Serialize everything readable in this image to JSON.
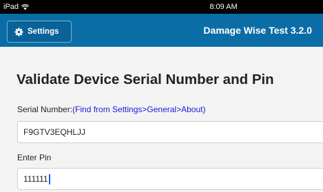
{
  "status_bar": {
    "device": "iPad",
    "time": "8:09 AM"
  },
  "nav": {
    "settings_label": "Settings",
    "title": "Damage Wise Test 3.2.0"
  },
  "page": {
    "title": "Validate Device Serial Number and Pin",
    "serial_label": "Serial Number:",
    "serial_hint": "(Find from Settings>General>About)",
    "serial_value": "F9GTV3EQHLJJ",
    "pin_label": "Enter Pin",
    "pin_value": "111111"
  },
  "colors": {
    "nav_background": "#0b6da6",
    "link": "#1a1adf",
    "page_background": "#f3f3f3"
  },
  "icons": {
    "status": "wifi-icon",
    "settings": "gear-icon"
  }
}
